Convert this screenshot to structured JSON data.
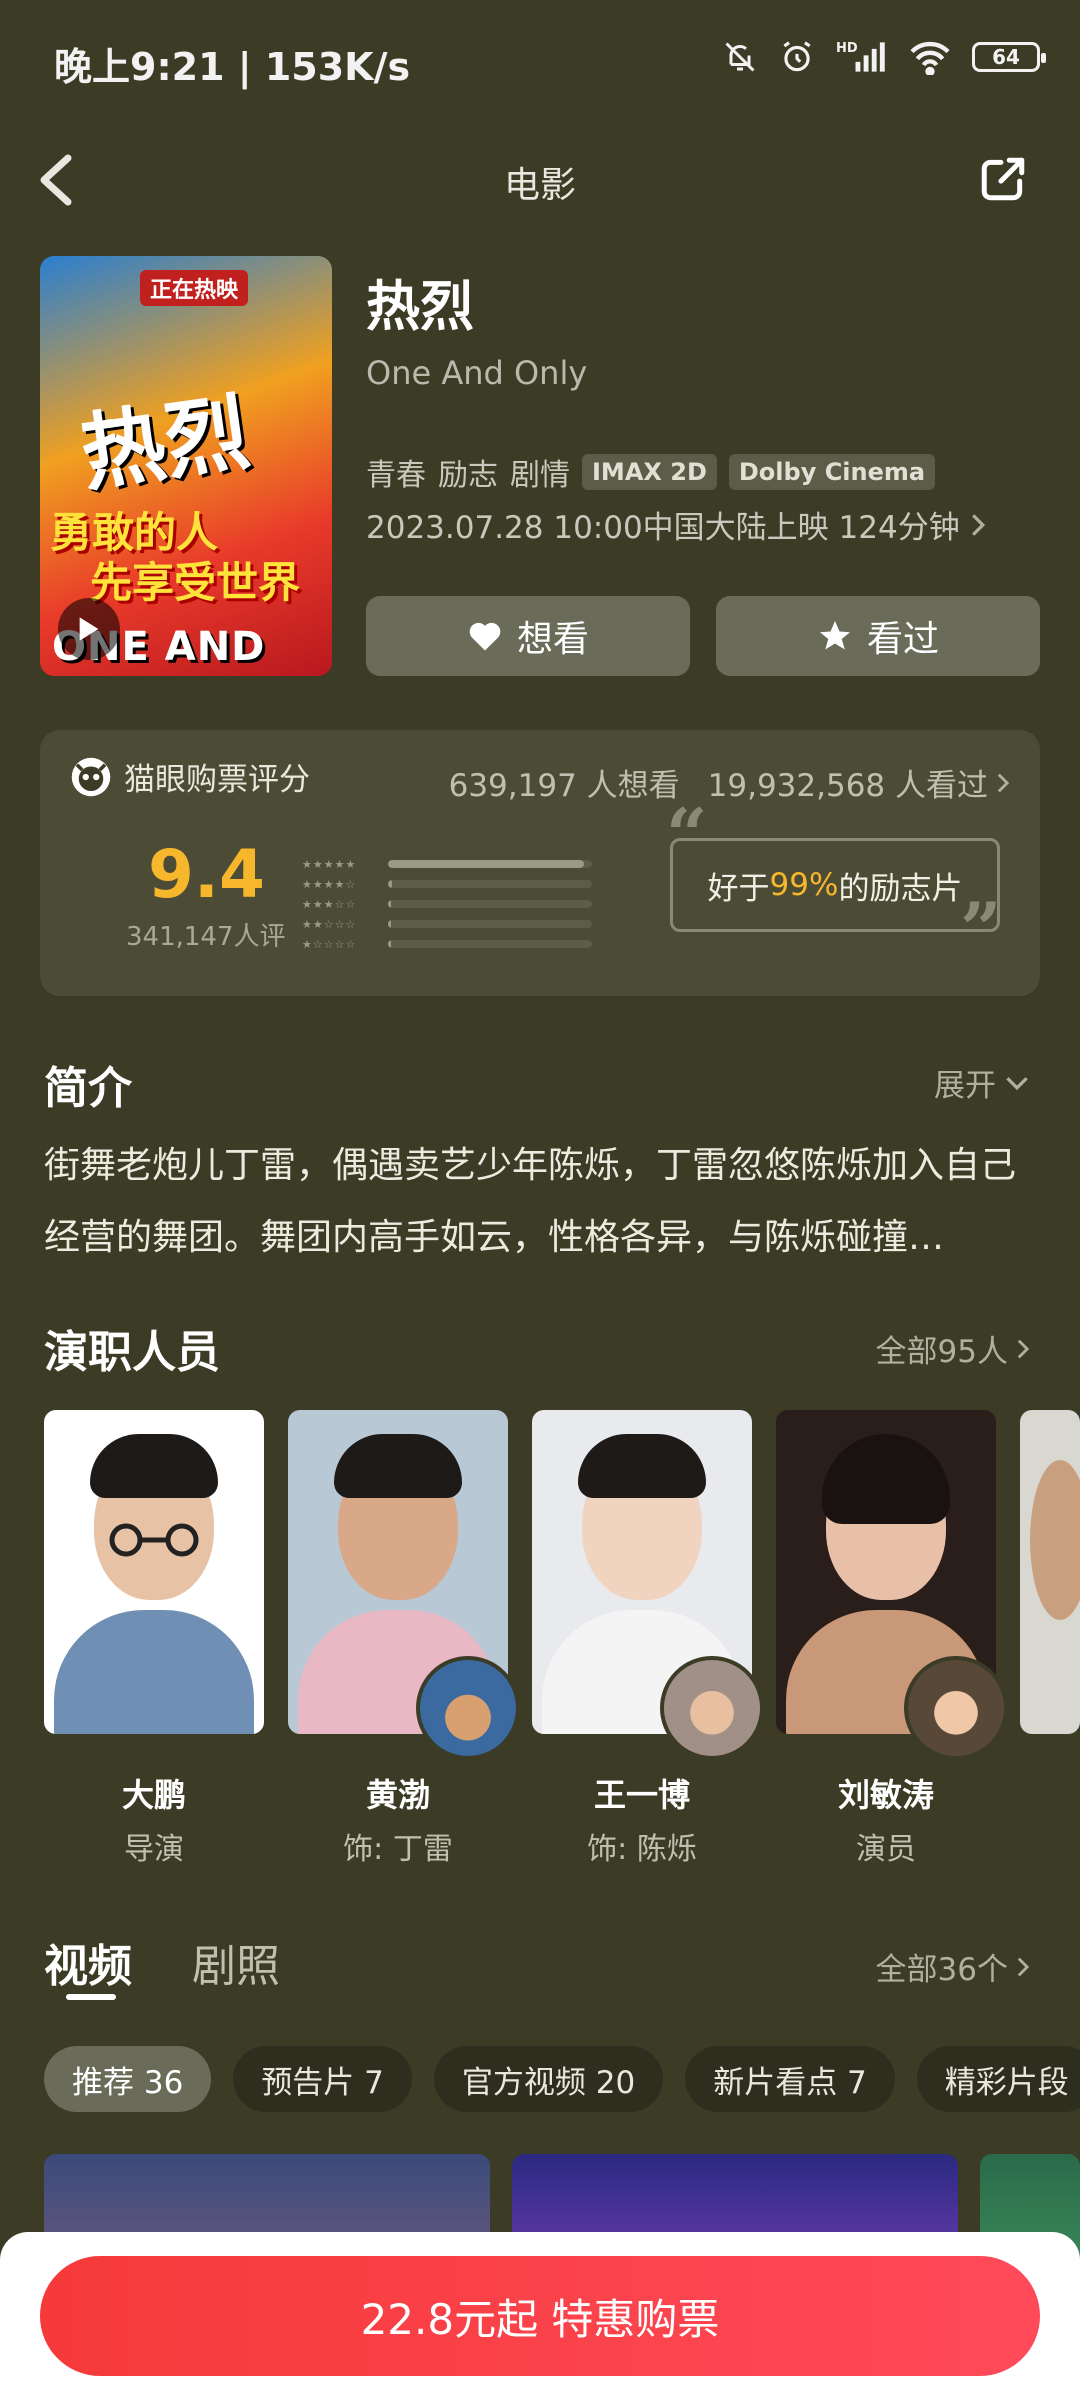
{
  "status_bar": {
    "time": "晚上9:21 | 153K/s",
    "battery": "64"
  },
  "nav": {
    "title": "电影"
  },
  "poster": {
    "badge": "正在热映",
    "title_art": "热烈",
    "slogan_line1": "勇敢的人",
    "slogan_line2": "先享受世界",
    "eng_art": "ONE AND ONLY"
  },
  "movie": {
    "title": "热烈",
    "english_title": "One And Only",
    "genres": [
      "青春",
      "励志",
      "剧情"
    ],
    "formats": [
      "IMAX 2D",
      "Dolby Cinema"
    ],
    "release": "2023.07.28 10:00中国大陆上映 124分钟",
    "want_label": "想看",
    "seen_label": "看过"
  },
  "rating": {
    "label": "猫眼购票评分",
    "want_count": "639,197 人想看",
    "seen_count": "19,932,568 人看过",
    "score": "9.4",
    "rating_count": "341,147人评",
    "distribution": [
      0.96,
      0.02,
      0.01,
      0.005,
      0.005
    ],
    "compare_prefix": "好于",
    "compare_pct": "99%",
    "compare_suffix": "的励志片"
  },
  "intro": {
    "title": "简介",
    "expand_label": "展开",
    "text": "街舞老炮儿丁雷，偶遇卖艺少年陈烁，丁雷忽悠陈烁加入自己经营的舞团。舞团内高手如云，性格各异，与陈烁碰撞…"
  },
  "cast": {
    "title": "演职人员",
    "more_label": "全部95人",
    "members": [
      {
        "name": "大鹏",
        "role": "导演"
      },
      {
        "name": "黄渤",
        "role": "饰: 丁雷"
      },
      {
        "name": "王一博",
        "role": "饰: 陈烁"
      },
      {
        "name": "刘敏涛",
        "role": "演员"
      }
    ]
  },
  "media": {
    "tab_video": "视频",
    "tab_stills": "剧照",
    "more_label": "全部36个",
    "chips": [
      "推荐 36",
      "预告片 7",
      "官方视频 20",
      "新片看点 7",
      "精彩片段"
    ]
  },
  "buy": {
    "label": "22.8元起 特惠购票"
  },
  "colors": {
    "background": "#3b3b26",
    "accent_score": "#f7b72c",
    "buy_button": "#f63a3a"
  }
}
